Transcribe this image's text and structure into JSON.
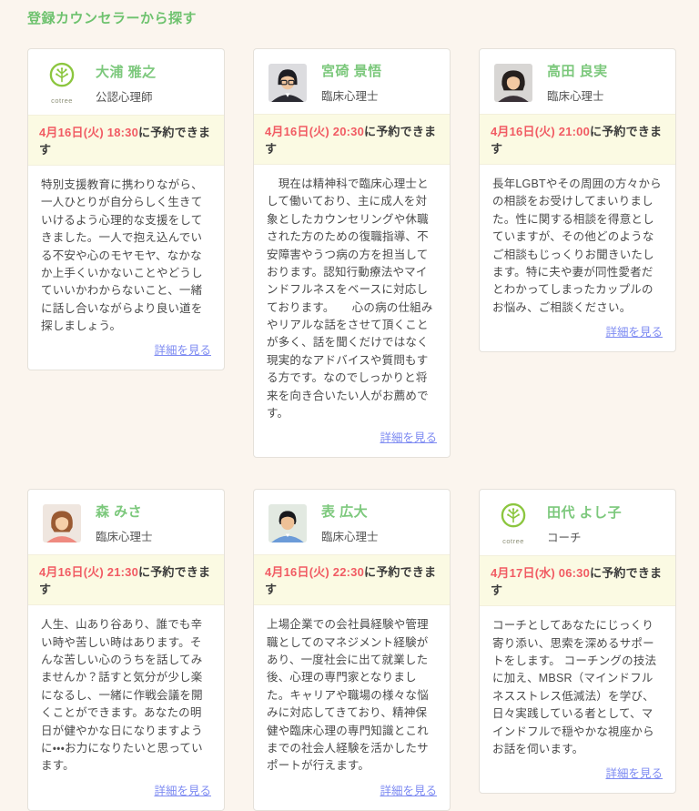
{
  "page": {
    "title": "登録カウンセラーから探す"
  },
  "brand": {
    "logo_label": "cotree",
    "logo_green": "#8CC63F"
  },
  "colors": {
    "page_background": "#FBF5EE",
    "heading_green": "#6EC26E",
    "name_green": "#7CC87C",
    "availability_background": "#FBFAE3",
    "availability_date_red": "#F15B63",
    "link_blue": "#7E8BF2",
    "card_border": "#E5E1DA"
  },
  "cards": [
    {
      "name": "大浦 雅之",
      "title": "公認心理師",
      "avatar": "cotree-logo",
      "availability_datetime": "4月16日(火) 18:30",
      "availability_suffix": "に予約できます",
      "description": "特別支援教育に携わりながら、一人ひとりが自分らしく生きていけるよう心理的な支援をしてきました。一人で抱え込んでいる不安や心のモヤモヤ、なかなか上手くいかないことやどうしていいかわからないこと、一緒に話し合いながらより良い道を探しましょう。",
      "link_label": "詳細を見る"
    },
    {
      "name": "宮碕 景悟",
      "title": "臨床心理士",
      "avatar": "photo-man-glasses-suit",
      "availability_datetime": "4月16日(火) 20:30",
      "availability_suffix": "に予約できます",
      "description": "　現在は精神科で臨床心理士として働いており、主に成人を対象としたカウンセリングや休職された方のための復職指導、不安障害やうつ病の方を担当しております。認知行動療法やマインドフルネスをベースに対応しております。　　心の病の仕組みやリアルな話をさせて頂くことが多く、話を聞くだけではなく現実的なアドバイスや質問もする方です。なのでしっかりと将来を向き合いたい人がお薦めです。",
      "link_label": "詳細を見る"
    },
    {
      "name": "高田 良実",
      "title": "臨床心理士",
      "avatar": "photo-woman-short-dark-hair",
      "availability_datetime": "4月16日(火) 21:00",
      "availability_suffix": "に予約できます",
      "description": "長年LGBTやその周囲の方々からの相談をお受けしてまいりました。性に関する相談を得意としていますが、その他どのようなご相談もじっくりお聞きいたします。特に夫や妻が同性愛者だとわかってしまったカップルのお悩み、ご相談ください。",
      "link_label": "詳細を見る"
    },
    {
      "name": "森 みさ",
      "title": "臨床心理士",
      "avatar": "photo-woman-brown-hair",
      "availability_datetime": "4月16日(火) 21:30",
      "availability_suffix": "に予約できます",
      "description": "人生、山あり谷あり、誰でも辛い時や苦しい時はあります。そんな苦しい心のうちを話してみませんか？話すと気分が少し楽になるし、一緒に作戦会議を開くことができます。あなたの明日が健やかな日になりますように・・・お力になりたいと思っています。",
      "link_label": "詳細を見る"
    },
    {
      "name": "表 広大",
      "title": "臨床心理士",
      "avatar": "photo-man-blue-shirt",
      "availability_datetime": "4月16日(火) 22:30",
      "availability_suffix": "に予約できます",
      "description": "上場企業での会社員経験や管理職としてのマネジメント経験があり、一度社会に出て就業した後、心理の専門家となりました。キャリアや職場の様々な悩みに対応してきており、精神保健や臨床心理の専門知識とこれまでの社会人経験を活かしたサポートが行えます。",
      "link_label": "詳細を見る"
    },
    {
      "name": "田代 よし子",
      "title": "コーチ",
      "avatar": "cotree-logo",
      "availability_datetime": "4月17日(水) 06:30",
      "availability_suffix": "に予約できます",
      "description": "コーチとしてあなたにじっくり寄り添い、思索を深めるサポートをします。 コーチングの技法に加え、MBSR（マインドフルネスストレス低減法）を学び、日々実践している者として、マインドフルで穏やかな視座からお話を伺います。",
      "link_label": "詳細を見る"
    }
  ]
}
